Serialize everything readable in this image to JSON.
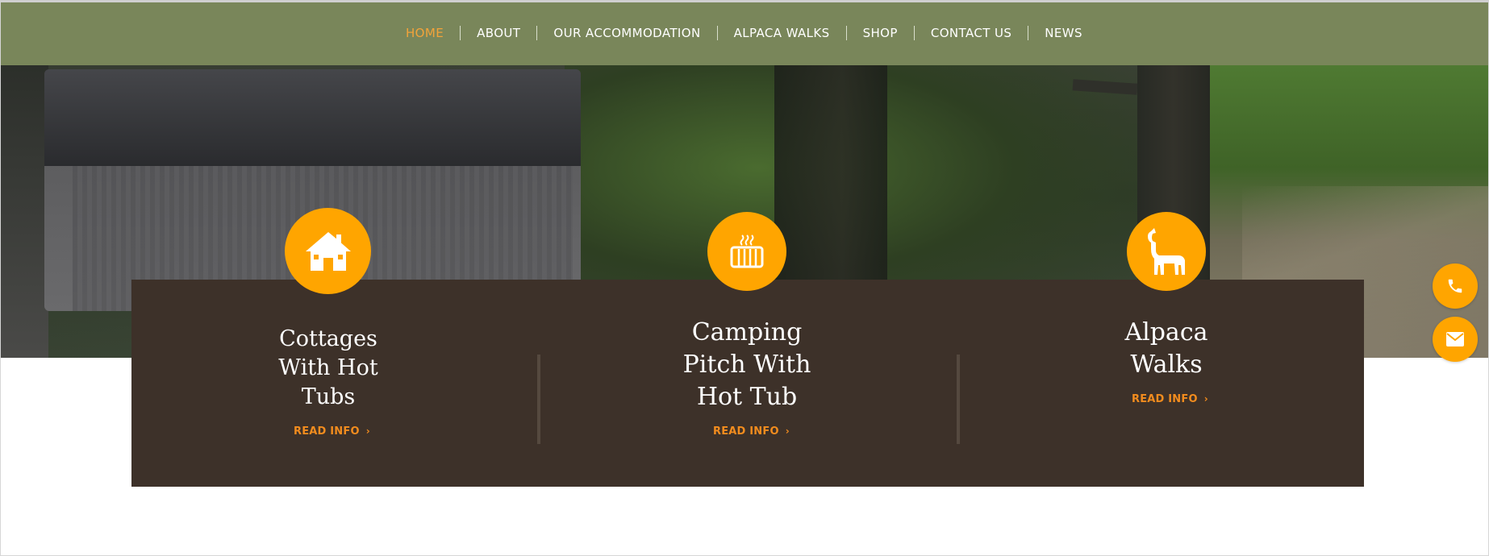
{
  "nav": {
    "items": [
      {
        "label": "HOME",
        "active": true
      },
      {
        "label": "ABOUT"
      },
      {
        "label": "OUR ACCOMMODATION"
      },
      {
        "label": "ALPACA WALKS"
      },
      {
        "label": "SHOP"
      },
      {
        "label": "CONTACT US"
      },
      {
        "label": "NEWS"
      }
    ]
  },
  "cards": [
    {
      "title": "Cottages With Hot Tubs",
      "link": "READ INFO",
      "icon": "house-icon"
    },
    {
      "title": "Camping Pitch With Hot Tub",
      "link": "READ INFO",
      "icon": "hot-tub-icon"
    },
    {
      "title": "Alpaca Walks",
      "link": "READ INFO",
      "icon": "alpaca-icon"
    }
  ],
  "floating": {
    "phone_icon": "phone-icon",
    "email_icon": "envelope-icon"
  },
  "colors": {
    "nav_bg": "#79865a",
    "nav_active": "#f2a33a",
    "accent": "#ffa500",
    "panel_bg": "#3d3129",
    "link": "#f28c1e"
  }
}
